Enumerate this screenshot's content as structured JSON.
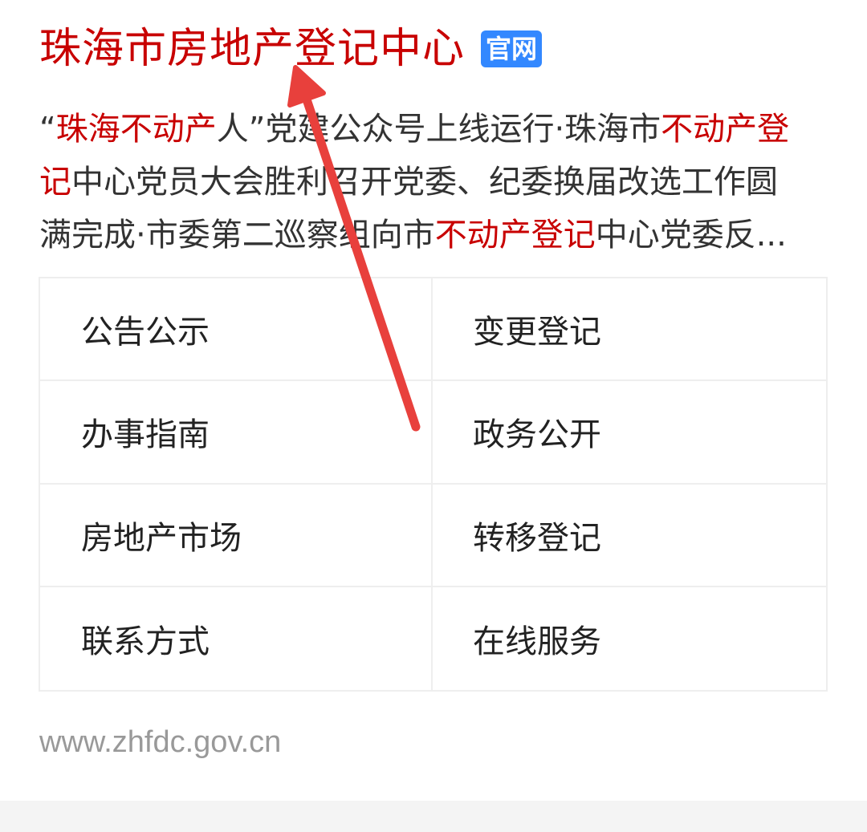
{
  "result": {
    "title": "珠海市房地产登记中心",
    "badge": "官网",
    "snippet": {
      "line1": [
        {
          "text": "“",
          "hl": false
        },
        {
          "text": "珠海不动产",
          "hl": true
        },
        {
          "text": "人”党建公众号上线运行·珠海市",
          "hl": false
        },
        {
          "text": "不动产登",
          "hl": true
        }
      ],
      "line2": [
        {
          "text": "记",
          "hl": true
        },
        {
          "text": "中心党员大会胜利召开党委、纪委换届改选工作圆",
          "hl": false
        }
      ],
      "line3": [
        {
          "text": "满完成·市委第二巡察组向市",
          "hl": false
        },
        {
          "text": "不动产登记",
          "hl": true
        },
        {
          "text": "中心党委反...",
          "hl": false
        }
      ]
    },
    "links": [
      "公告公示",
      "变更登记",
      "办事指南",
      "政务公开",
      "房地产市场",
      "转移登记",
      "联系方式",
      "在线服务"
    ],
    "url": "www.zhfdc.gov.cn"
  },
  "colors": {
    "title": "#c80000",
    "highlight": "#c80000",
    "badge": "#3388ff",
    "arrow": "#e8403c",
    "url": "#999999"
  },
  "annotation": {
    "icon": "arrow-icon"
  }
}
